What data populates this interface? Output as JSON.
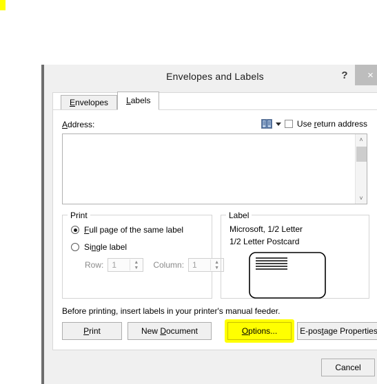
{
  "window": {
    "title": "Envelopes and Labels",
    "help_icon": "?",
    "close_icon": "×"
  },
  "tabs": [
    {
      "label": "Envelopes",
      "active": false
    },
    {
      "label": "Labels",
      "active": true
    }
  ],
  "address": {
    "label": "Address:",
    "value": "",
    "addressbook_icon": "address-book-icon",
    "dropdown_icon": "chevron-down-icon",
    "use_return_address_label": "Use return address",
    "use_return_address_checked": false,
    "scroll_up_icon": "˄",
    "scroll_down_icon": "˅"
  },
  "print_group": {
    "title": "Print",
    "options": [
      {
        "label": "Full page of the same label",
        "selected": true
      },
      {
        "label": "Single label",
        "selected": false
      }
    ],
    "row_label": "Row:",
    "row_value": "1",
    "column_label": "Column:",
    "column_value": "1",
    "spin_up_icon": "▲",
    "spin_down_icon": "▼",
    "disabled": true
  },
  "label_group": {
    "title": "Label",
    "vendor_line": "Microsoft, 1/2 Letter",
    "product_line": "1/2 Letter Postcard",
    "preview_icon": "label-preview-graphic"
  },
  "note": "Before printing, insert labels in your printer's manual feeder.",
  "buttons": {
    "print": "Print",
    "new_document": "New Document",
    "options": "Options...",
    "epostage": "E-postage Properties...",
    "cancel": "Cancel"
  },
  "annotation": {
    "highlight_color": "#ffff00",
    "highlight_target": "Options..."
  }
}
